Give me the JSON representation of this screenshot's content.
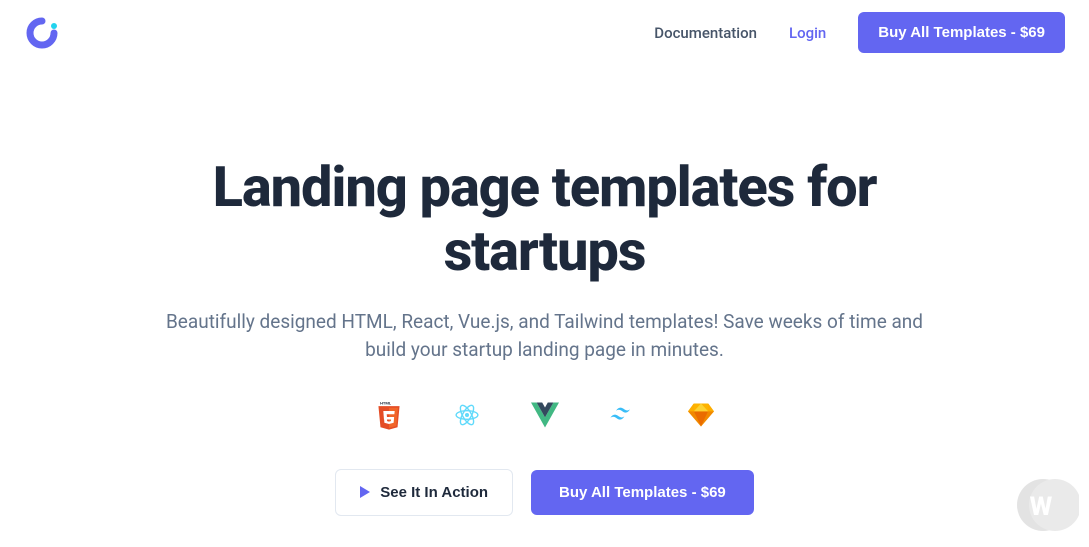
{
  "nav": {
    "documentation": "Documentation",
    "login": "Login",
    "buy_btn": "Buy All Templates - $69"
  },
  "hero": {
    "title": "Landing page templates for startups",
    "subtitle": "Beautifully designed HTML, React, Vue.js, and Tailwind templates! Save weeks of time and build your startup landing page in minutes."
  },
  "tech": {
    "html5": "html5-icon",
    "react": "react-icon",
    "vue": "vue-icon",
    "tailwind": "tailwind-icon",
    "sketch": "sketch-icon"
  },
  "cta": {
    "see_action": "See It In Action",
    "buy": "Buy All Templates - $69"
  }
}
